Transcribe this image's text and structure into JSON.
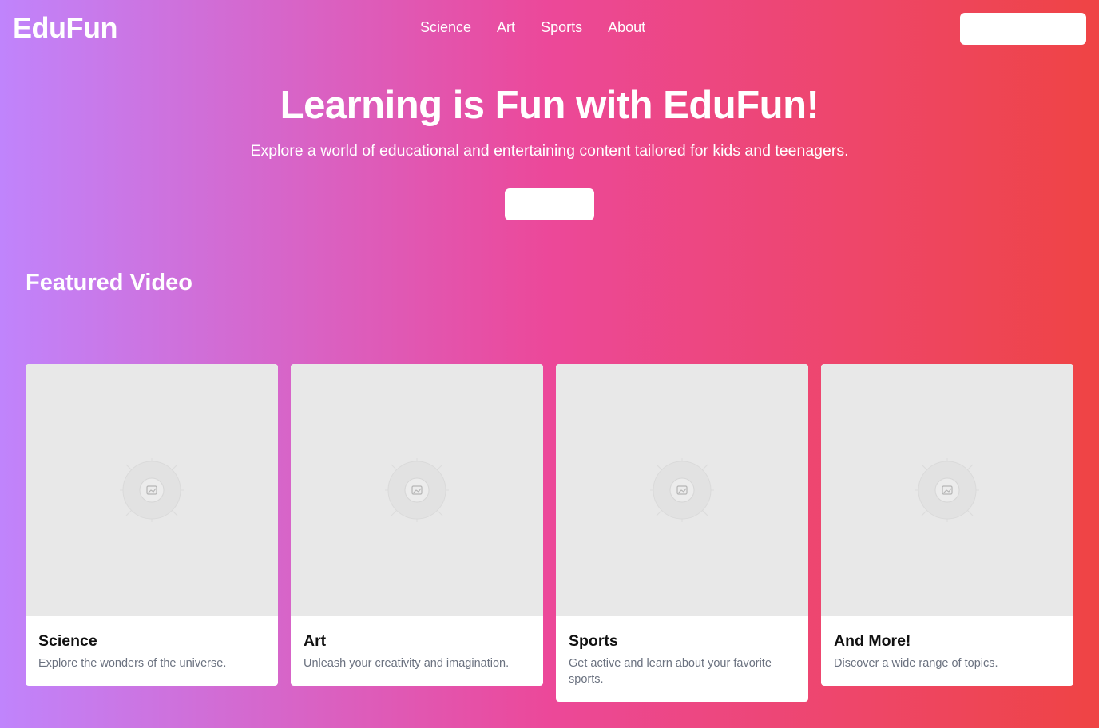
{
  "brand": {
    "name": "EduFun"
  },
  "nav": {
    "items": [
      {
        "label": "Science"
      },
      {
        "label": "Art"
      },
      {
        "label": "Sports"
      },
      {
        "label": "About"
      }
    ],
    "action_label": ""
  },
  "hero": {
    "title": "Learning is Fun with EduFun!",
    "subtitle": "Explore a world of educational and entertaining content tailored for kids and teenagers.",
    "cta_label": ""
  },
  "featured": {
    "heading": "Featured Video",
    "cards": [
      {
        "title": "Science",
        "description": "Explore the wonders of the universe.",
        "image_icon": "image-placeholder-icon"
      },
      {
        "title": "Art",
        "description": "Unleash your creativity and imagination.",
        "image_icon": "image-placeholder-icon"
      },
      {
        "title": "Sports",
        "description": "Get active and learn about your favorite sports.",
        "image_icon": "image-placeholder-icon"
      },
      {
        "title": "And More!",
        "description": "Discover a wide range of topics.",
        "image_icon": "image-placeholder-icon"
      }
    ]
  },
  "colors": {
    "gradient_start": "#c084fc",
    "gradient_mid": "#ec4899",
    "gradient_end": "#ef4444",
    "card_bg": "#ffffff",
    "placeholder_bg": "#e8e8e8"
  }
}
